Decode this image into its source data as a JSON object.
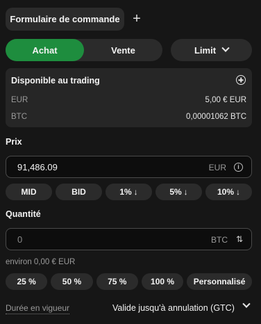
{
  "header": {
    "tab_label": "Formulaire de commande",
    "add_tab_symbol": "+"
  },
  "side": {
    "buy_label": "Achat",
    "sell_label": "Vente",
    "active": "buy",
    "buy_color": "#1e8d3e"
  },
  "order_type": {
    "selected": "Limit"
  },
  "available": {
    "title": "Disponible au trading",
    "balances": [
      {
        "currency": "EUR",
        "amount": "5,00 € EUR"
      },
      {
        "currency": "BTC",
        "amount": "0,00001062 BTC"
      }
    ]
  },
  "price": {
    "label": "Prix",
    "value": "91,486.09",
    "unit": "EUR",
    "presets": [
      "MID",
      "BID",
      "1%",
      "5%",
      "10%"
    ]
  },
  "quantity": {
    "label": "Quantité",
    "value": "0",
    "unit": "BTC",
    "approx": "environ 0,00 € EUR",
    "presets": [
      "25 %",
      "50 %",
      "75 %",
      "100 %",
      "Personnalisé"
    ]
  },
  "time_in_force": {
    "label": "Durée en vigueur",
    "value": "Valide jusqu'à annulation (GTC)"
  }
}
